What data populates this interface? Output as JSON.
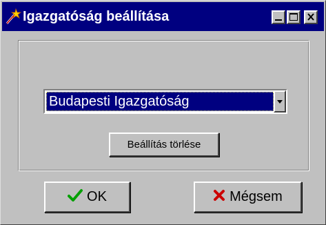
{
  "window": {
    "title": "Igazgatóság beállítása",
    "icon": "wand-icon"
  },
  "titlebar_buttons": [
    "minimize-icon",
    "maximize-icon",
    "close-icon"
  ],
  "directorate_select": {
    "selected": "Budapesti Igazgatóság"
  },
  "buttons": {
    "clear_label": "Beállítás törlése",
    "ok_label": "OK",
    "ok_icon": "checkmark-icon",
    "cancel_label": "Mégsem",
    "cancel_icon": "x-icon"
  },
  "colors": {
    "titlebar": "#000080",
    "selection": "#000080",
    "face": "#c0c0c0",
    "ok_check": "#00a000",
    "cancel_x": "#cc0000"
  }
}
